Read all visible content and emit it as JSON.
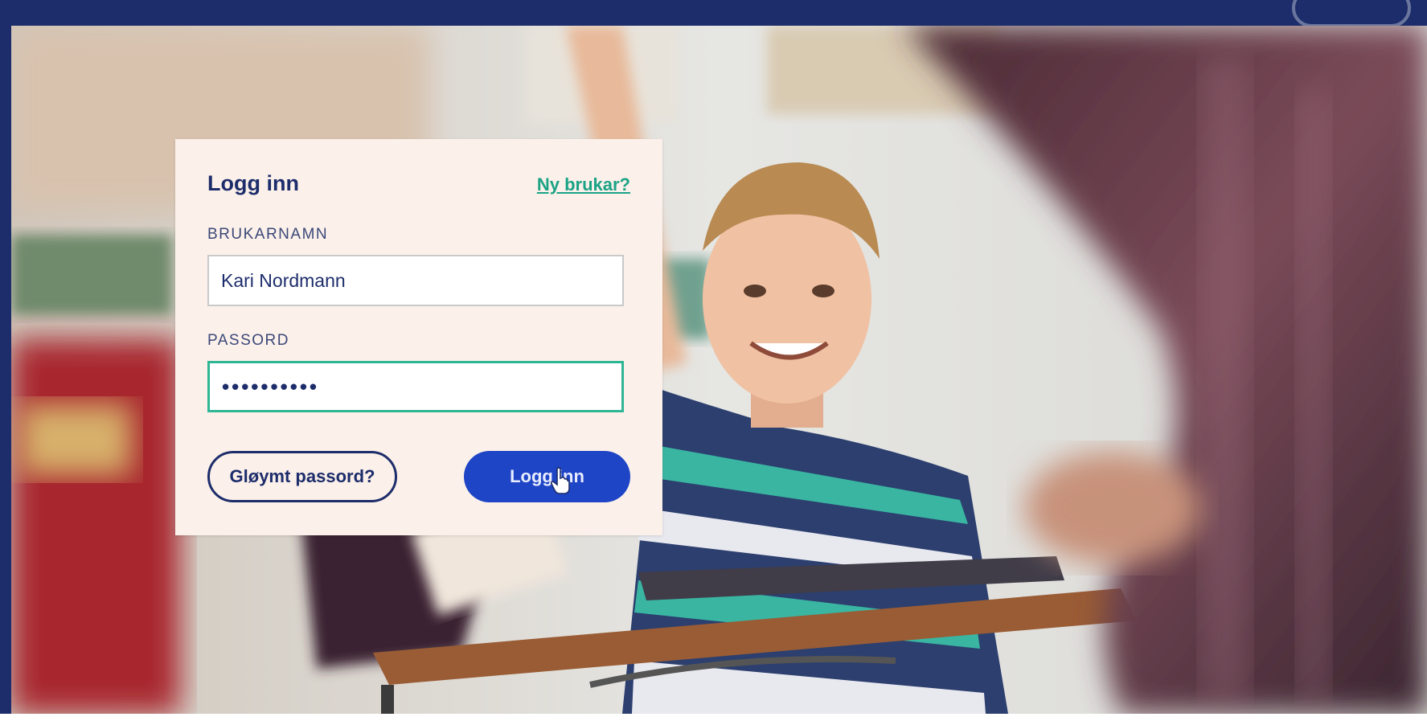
{
  "login": {
    "title": "Logg inn",
    "new_user_link": "Ny brukar?",
    "username_label": "BRUKARNAMN",
    "username_value": "Kari Nordmann",
    "password_label": "PASSORD",
    "password_value": "••••••••••",
    "forgot_button": "Gløymt passord?",
    "login_button": "Logg inn"
  },
  "icons": {
    "cursor": "hand-pointer-icon"
  },
  "colors": {
    "brand_navy": "#1d2d6b",
    "accent_teal": "#1ba386",
    "focus_green": "#2fb694",
    "button_blue": "#1e45c6",
    "card_bg": "#fcf1ea"
  }
}
